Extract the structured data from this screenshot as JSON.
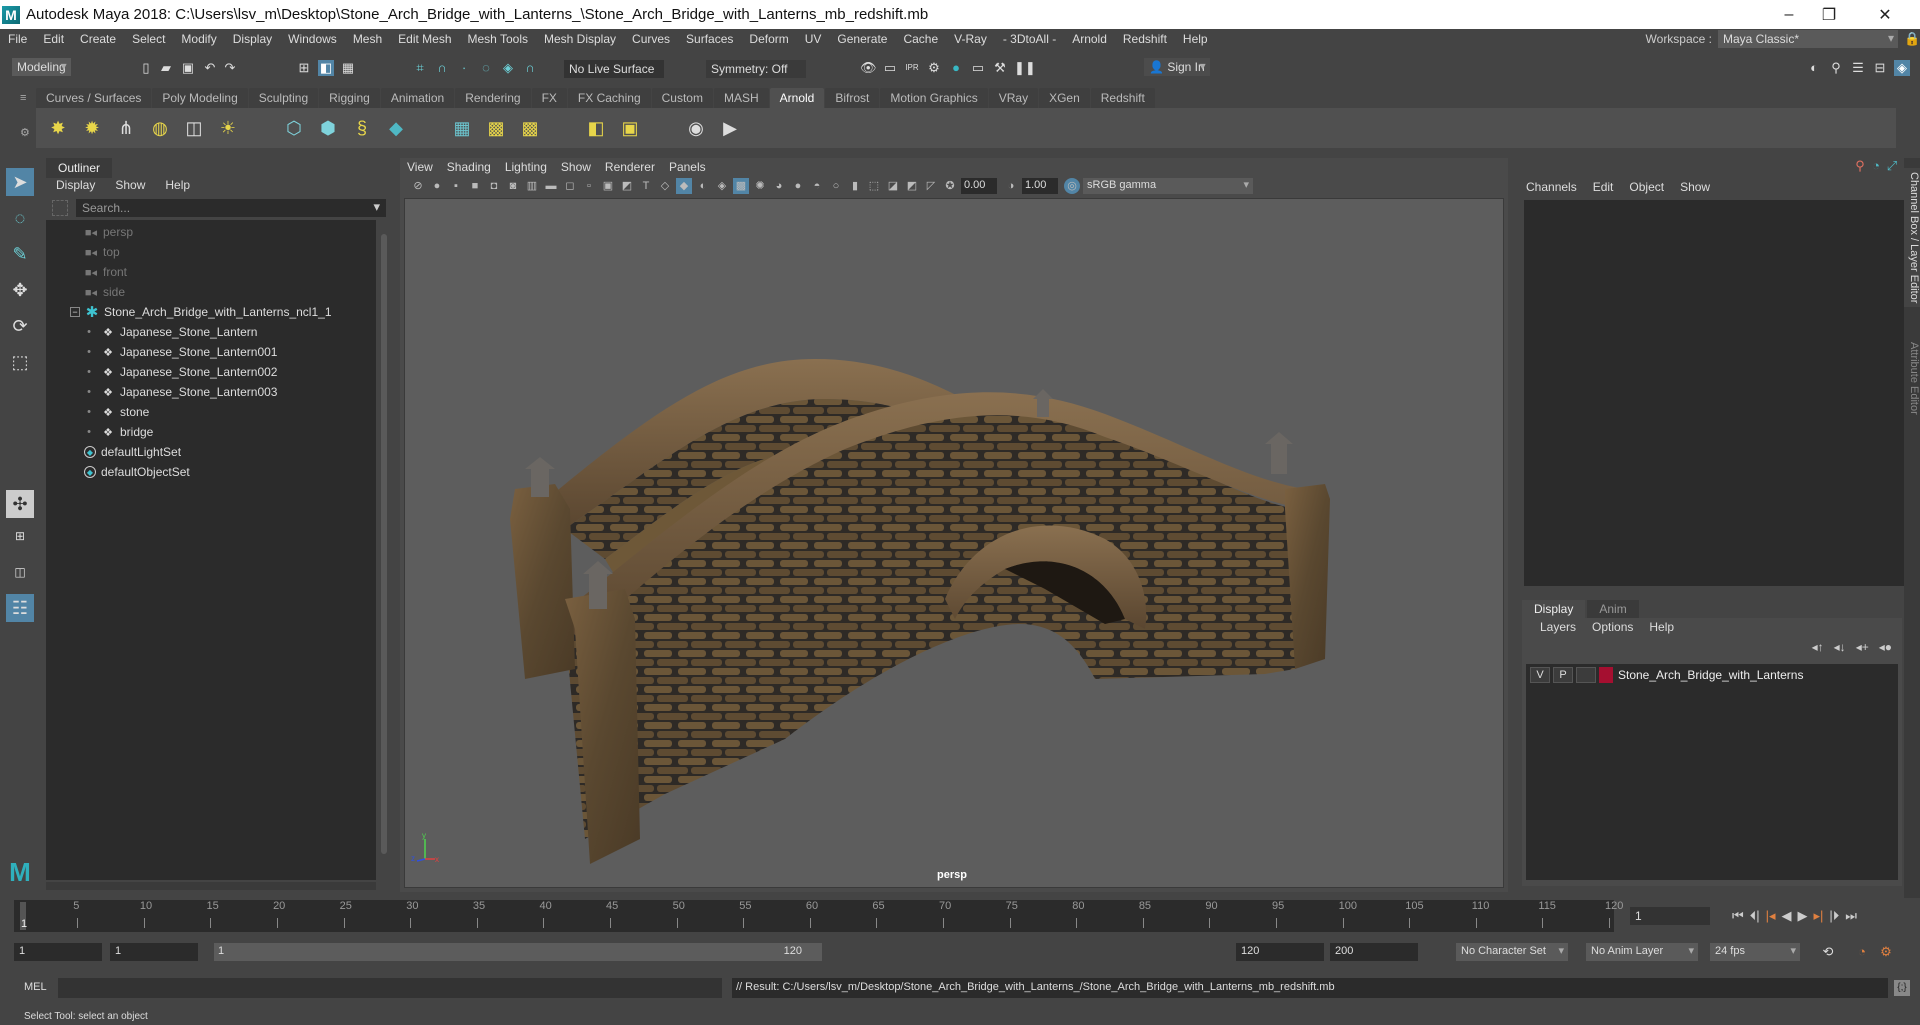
{
  "window": {
    "title": "Autodesk Maya 2018: C:\\Users\\lsv_m\\Desktop\\Stone_Arch_Bridge_with_Lanterns_\\Stone_Arch_Bridge_with_Lanterns_mb_redshift.mb",
    "logo": "M",
    "controls": {
      "minimize": "–",
      "maximize": "❐",
      "close": "✕"
    }
  },
  "menubar": {
    "items": [
      "File",
      "Edit",
      "Create",
      "Select",
      "Modify",
      "Display",
      "Windows",
      "Mesh",
      "Edit Mesh",
      "Mesh Tools",
      "Mesh Display",
      "Curves",
      "Surfaces",
      "Deform",
      "UV",
      "Generate",
      "Cache",
      "V-Ray",
      "- 3DtoAll -",
      "Arnold",
      "Redshift",
      "Help"
    ],
    "workspace_label": "Workspace :",
    "workspace_value": "Maya Classic*"
  },
  "statusline": {
    "mode": "Modeling",
    "live_surface": "No Live Surface",
    "symmetry": "Symmetry: Off",
    "sign_in": "Sign In"
  },
  "shelf": {
    "tabs": [
      "Curves / Surfaces",
      "Poly Modeling",
      "Sculpting",
      "Rigging",
      "Animation",
      "Rendering",
      "FX",
      "FX Caching",
      "Custom",
      "MASH",
      "Arnold",
      "Bifrost",
      "Motion Graphics",
      "VRay",
      "XGen",
      "Redshift"
    ],
    "active_tab": "Arnold"
  },
  "outliner": {
    "title": "Outliner",
    "menus": [
      "Display",
      "Show",
      "Help"
    ],
    "search_placeholder": "Search...",
    "items": [
      {
        "label": "persp",
        "type": "camera",
        "dim": true,
        "indent": 0
      },
      {
        "label": "top",
        "type": "camera",
        "dim": true,
        "indent": 0
      },
      {
        "label": "front",
        "type": "camera",
        "dim": true,
        "indent": 0
      },
      {
        "label": "side",
        "type": "camera",
        "dim": true,
        "indent": 0
      },
      {
        "label": "Stone_Arch_Bridge_with_Lanterns_ncl1_1",
        "type": "group",
        "expanded": true,
        "indent": 0
      },
      {
        "label": "Japanese_Stone_Lantern",
        "type": "mesh",
        "indent": 1
      },
      {
        "label": "Japanese_Stone_Lantern001",
        "type": "mesh",
        "indent": 1
      },
      {
        "label": "Japanese_Stone_Lantern002",
        "type": "mesh",
        "indent": 1
      },
      {
        "label": "Japanese_Stone_Lantern003",
        "type": "mesh",
        "indent": 1
      },
      {
        "label": "stone",
        "type": "mesh",
        "indent": 1
      },
      {
        "label": "bridge",
        "type": "mesh",
        "indent": 1
      },
      {
        "label": "defaultLightSet",
        "type": "set",
        "indent": 0
      },
      {
        "label": "defaultObjectSet",
        "type": "set",
        "indent": 0
      }
    ]
  },
  "viewport": {
    "menus": [
      "View",
      "Shading",
      "Lighting",
      "Show",
      "Renderer",
      "Panels"
    ],
    "exposure": "0.00",
    "gamma": "1.00",
    "color_space": "sRGB gamma",
    "camera_label": "persp",
    "axis": {
      "x": "x",
      "y": "y",
      "z": "z"
    }
  },
  "channel_box": {
    "menus": [
      "Channels",
      "Edit",
      "Object",
      "Show"
    ]
  },
  "layer_editor": {
    "tabs": [
      "Display",
      "Anim"
    ],
    "active_tab": "Display",
    "menus": [
      "Layers",
      "Options",
      "Help"
    ],
    "layers": [
      {
        "visible": "V",
        "playback": "P",
        "color": "#a50f30",
        "name": "Stone_Arch_Bridge_with_Lanterns"
      }
    ]
  },
  "side_tabs": [
    "Channel Box / Layer Editor",
    "Attribute Editor"
  ],
  "timeslider": {
    "ticks": [
      5,
      10,
      15,
      20,
      25,
      30,
      35,
      40,
      45,
      50,
      55,
      60,
      65,
      70,
      75,
      80,
      85,
      90,
      95,
      100,
      105,
      110,
      115,
      120
    ],
    "start": 1,
    "end": 120,
    "current_frame": "1",
    "current_frame_field": "1"
  },
  "range": {
    "start_field": "1",
    "playback_start": "1",
    "bar_start": "1",
    "bar_end": "120",
    "playback_end": "120",
    "anim_end": "200",
    "character_set": "No Character Set",
    "anim_layer": "No Anim Layer",
    "fps": "24 fps"
  },
  "command_line": {
    "label": "MEL",
    "result": "// Result: C:/Users/lsv_m/Desktop/Stone_Arch_Bridge_with_Lanterns_/Stone_Arch_Bridge_with_Lanterns_mb_redshift.mb"
  },
  "help_line": "Select Tool: select an object"
}
